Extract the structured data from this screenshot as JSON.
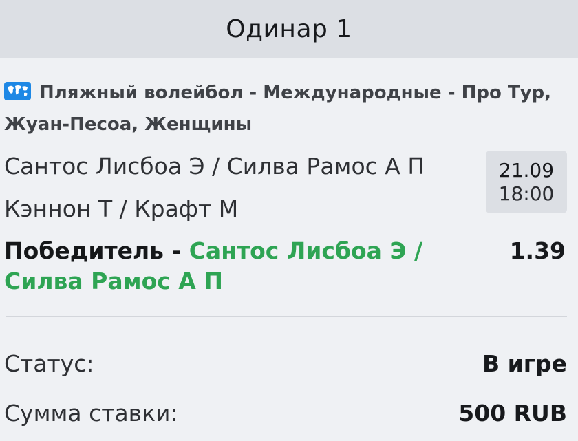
{
  "header": {
    "title": "Одинар 1"
  },
  "event": {
    "icon": "world-map-icon",
    "league": "Пляжный волейбол - Международные - Про Тур, Жуан-Песоа, Женщины",
    "team1": "Сантос Лисбоа Э / Силва Рамос А П",
    "team2": "Кэннон Т / Крафт М",
    "date": "21.09",
    "time": "18:00"
  },
  "bet": {
    "market_label": "Победитель",
    "separator": " - ",
    "selection": "Сантос Лисбоа Э / Силва Рамос А П",
    "odds": "1.39"
  },
  "details": {
    "status_label": "Статус:",
    "status_value": "В игре",
    "stake_label": "Сумма ставки:",
    "stake_value": "500 RUB"
  },
  "colors": {
    "accent_green": "#2ea453",
    "icon_blue": "#1e88e5",
    "background": "#eff1f4",
    "header_bg": "#dcdfe4"
  }
}
